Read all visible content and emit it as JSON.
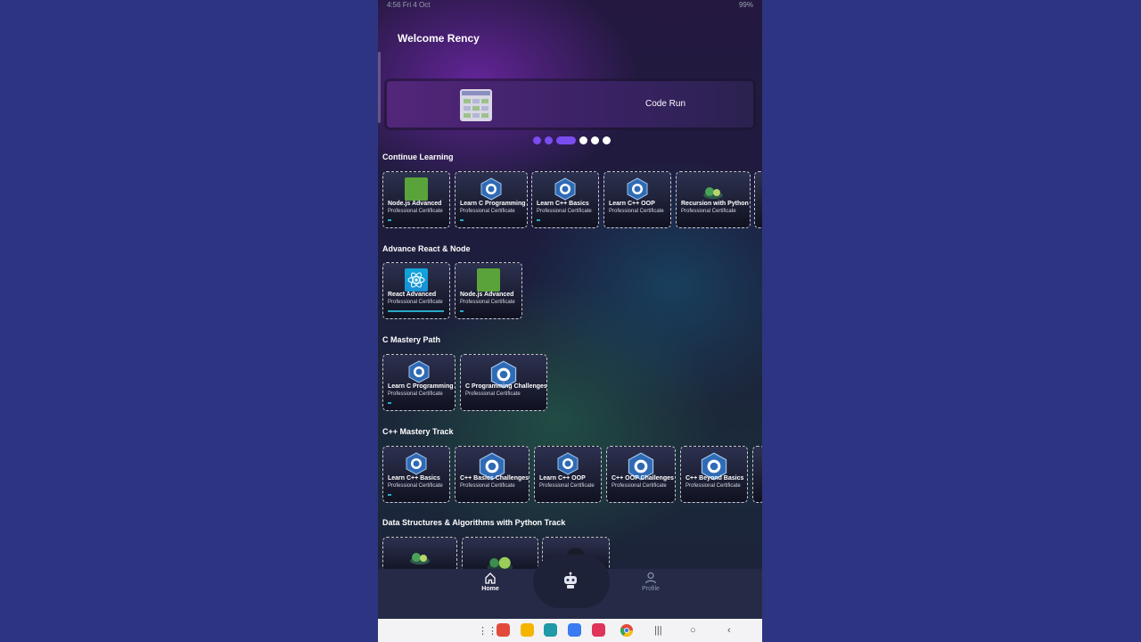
{
  "status_bar": {
    "left": "4:56 Fri 4 Oct",
    "right": "99%"
  },
  "header": {
    "welcome": "Welcome Rency"
  },
  "banner": {
    "label": "Code Run"
  },
  "carousel": {
    "count": 6,
    "active_index": 2
  },
  "sections": [
    {
      "title": "Continue Learning",
      "cards": [
        {
          "title": "Node.js Advanced",
          "subtitle": "Professional Certificate",
          "icon": "nodejs-icon"
        },
        {
          "title": "Learn C Programming",
          "subtitle": "Professional Certificate",
          "icon": "c-language-icon"
        },
        {
          "title": "Learn C++ Basics",
          "subtitle": "Professional Certificate",
          "icon": "cpp-icon"
        },
        {
          "title": "Learn C++ OOP",
          "subtitle": "Professional Certificate",
          "icon": "cpp-icon"
        },
        {
          "title": "Recursion with Python",
          "subtitle": "Professional Certificate",
          "icon": "python-illustration-icon"
        }
      ]
    },
    {
      "title": "Advance React & Node",
      "cards": [
        {
          "title": "React Advanced",
          "subtitle": "Professional Certificate",
          "icon": "react-icon",
          "progress": 1.0
        },
        {
          "title": "Node.js Advanced",
          "subtitle": "Professional Certificate",
          "icon": "nodejs-icon"
        }
      ]
    },
    {
      "title": "C Mastery Path",
      "cards": [
        {
          "title": "Learn C Programming",
          "subtitle": "Professional Certificate",
          "icon": "c-language-icon"
        },
        {
          "title": "C Programming Challenges",
          "subtitle": "Professional Certificate",
          "icon": "c-language-icon"
        }
      ]
    },
    {
      "title": "C++ Mastery Track",
      "cards": [
        {
          "title": "Learn C++ Basics",
          "subtitle": "Professional Certificate",
          "icon": "cpp-icon"
        },
        {
          "title": "C++ Basics Challenges",
          "subtitle": "Professional Certificate",
          "icon": "cpp-icon"
        },
        {
          "title": "Learn C++ OOP",
          "subtitle": "Professional Certificate",
          "icon": "cpp-icon"
        },
        {
          "title": "C++ OOP Challenges",
          "subtitle": "Professional Certificate",
          "icon": "cpp-icon"
        },
        {
          "title": "C++ Beyond Basics",
          "subtitle": "Professional Certificate",
          "icon": "cpp-icon"
        }
      ]
    },
    {
      "title": "Data Structures & Algorithms with Python Track",
      "cards": []
    }
  ],
  "bottom_nav": {
    "home": "Home",
    "profile": "Profile"
  },
  "colors": {
    "accent": "#7b4cf0",
    "progress": "#28a9c8",
    "node": "#5aa33b",
    "c_hex": "#2f6bb5"
  }
}
